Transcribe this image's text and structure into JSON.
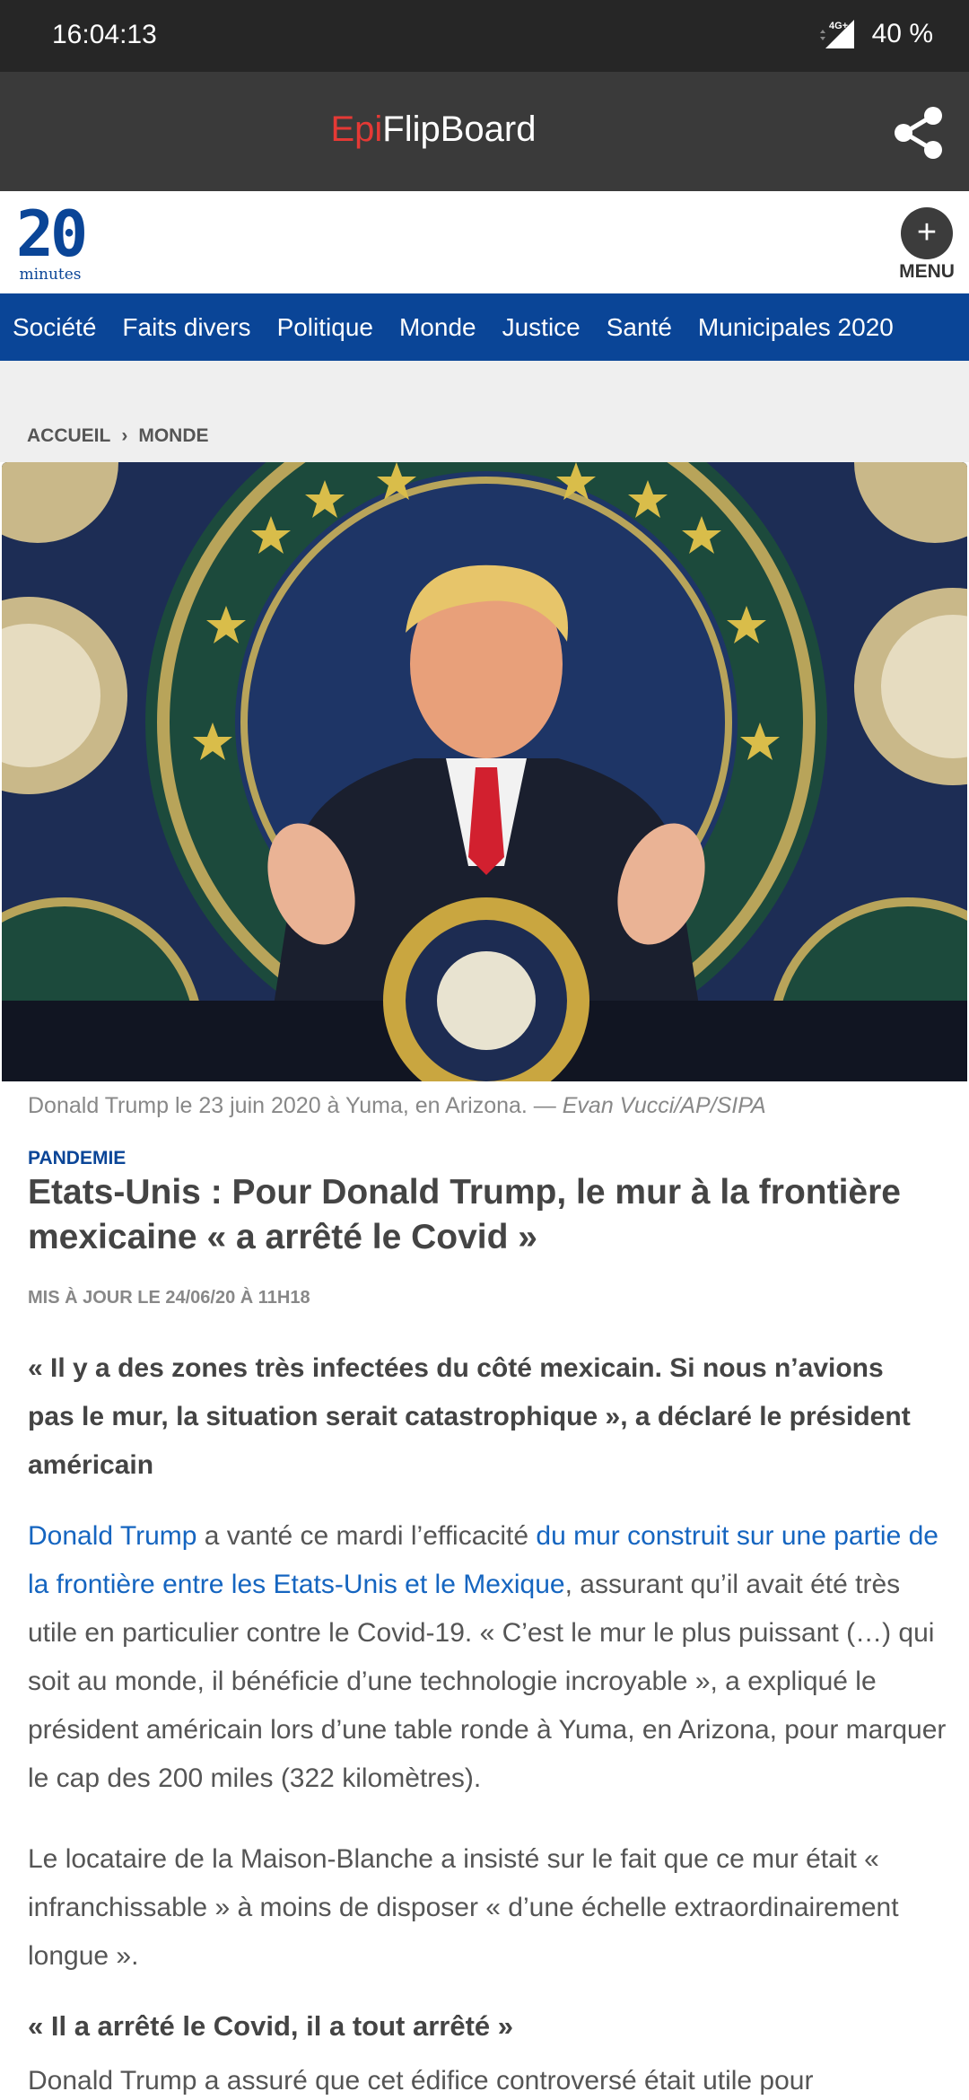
{
  "status_bar": {
    "time": "16:04:13",
    "network": "4G+",
    "battery": "40 %"
  },
  "app_bar": {
    "title_prefix": "Epi",
    "title_suffix": "FlipBoard",
    "share_icon": "share-icon"
  },
  "site": {
    "logo_text_top": "20",
    "logo_text_bottom": "minutes",
    "menu_label": "MENU",
    "menu_icon_glyph": "+"
  },
  "categories": [
    "Société",
    "Faits divers",
    "Politique",
    "Monde",
    "Justice",
    "Santé",
    "Municipales 2020"
  ],
  "breadcrumb": {
    "home": "ACCUEIL",
    "separator": "›",
    "section": "MONDE"
  },
  "article": {
    "caption_text": "Donald Trump le 23 juin 2020 à Yuma, en Arizona. — ",
    "caption_credit": "Evan Vucci/AP/SIPA",
    "kicker": "PANDEMIE",
    "headline": "Etats-Unis : Pour Donald Trump, le mur à la frontière mexicaine « a arrêté le Covid »",
    "updated": "MIS À JOUR LE 24/06/20 À 11H18",
    "lead": "« Il y a des zones très infectées du côté mexicain. Si nous n’avions pas le mur, la situation serait catastrophique », a déclaré le président américain",
    "p1_link1": "Donald Trump",
    "p1_text1": " a vanté ce mardi l’efficacité ",
    "p1_link2": "du mur construit sur une partie de la frontière entre les Etats-Unis et le Mexique",
    "p1_text2": ", assurant qu’il avait été très utile en particulier contre le Covid-19. « C’est le mur le plus puissant (…) qui soit au monde, il bénéficie d’une technologie incroyable », a expliqué le président américain lors d’une table ronde à Yuma, en Arizona, pour marquer le cap des 200 miles (322 kilomètres).",
    "p2": "Le locataire de la Maison-Blanche a insisté sur le fait que ce mur était « infranchissable » à moins de disposer « d’une échelle extraordinairement longue ».",
    "subhead": "« Il a arrêté le Covid, il a tout arrêté »",
    "p3": "Donald Trump a assuré que cet édifice controversé était utile pour"
  },
  "colors": {
    "status_bg": "#262626",
    "appbar_bg": "#3a3a3a",
    "brand_red": "#e53935",
    "nav_blue": "#0a4597",
    "link_blue": "#1565c0"
  }
}
